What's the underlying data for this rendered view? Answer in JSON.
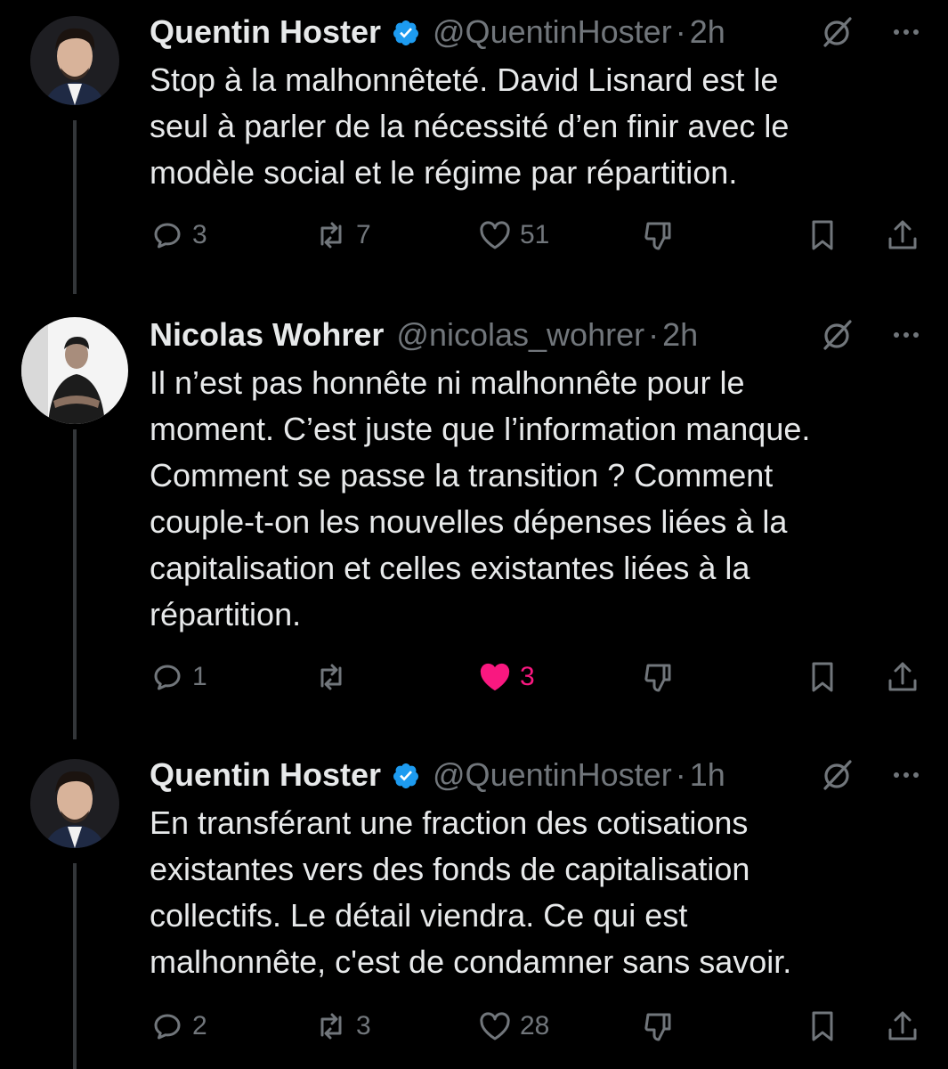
{
  "colors": {
    "background": "#000000",
    "text": "#e7e9ea",
    "muted": "#71767b",
    "verified": "#1d9bf0",
    "like_active": "#f91880",
    "thread_line": "#333639"
  },
  "tweets": [
    {
      "name": "Quentin Hoster",
      "verified": true,
      "handle": "@QuentinHoster",
      "separator": "·",
      "time": "2h",
      "text": "Stop à la malhonnêteté. David Lisnard est le\nseul à parler de la nécessité d’en finir avec le\nmodèle social et le régime par répartition.",
      "replies": "3",
      "retweets": "7",
      "likes": "51",
      "liked": false
    },
    {
      "name": "Nicolas Wohrer",
      "verified": false,
      "handle": "@nicolas_wohrer",
      "separator": "·",
      "time": "2h",
      "text": "Il n’est pas honnête ni malhonnête pour le\nmoment. C’est juste que l’information manque.\nComment se passe la transition ? Comment\ncouple-t-on les nouvelles dépenses liées à la\ncapitalisation et celles existantes liées à la\nrépartition.",
      "replies": "1",
      "retweets": "",
      "likes": "3",
      "liked": true
    },
    {
      "name": "Quentin Hoster",
      "verified": true,
      "handle": "@QuentinHoster",
      "separator": "·",
      "time": "1h",
      "text": "En transférant une fraction des cotisations\nexistantes vers des fonds de capitalisation\ncollectifs. Le détail viendra. Ce qui est\nmalhonnête, c'est de condamner sans savoir.",
      "replies": "2",
      "retweets": "3",
      "likes": "28",
      "liked": false
    }
  ]
}
